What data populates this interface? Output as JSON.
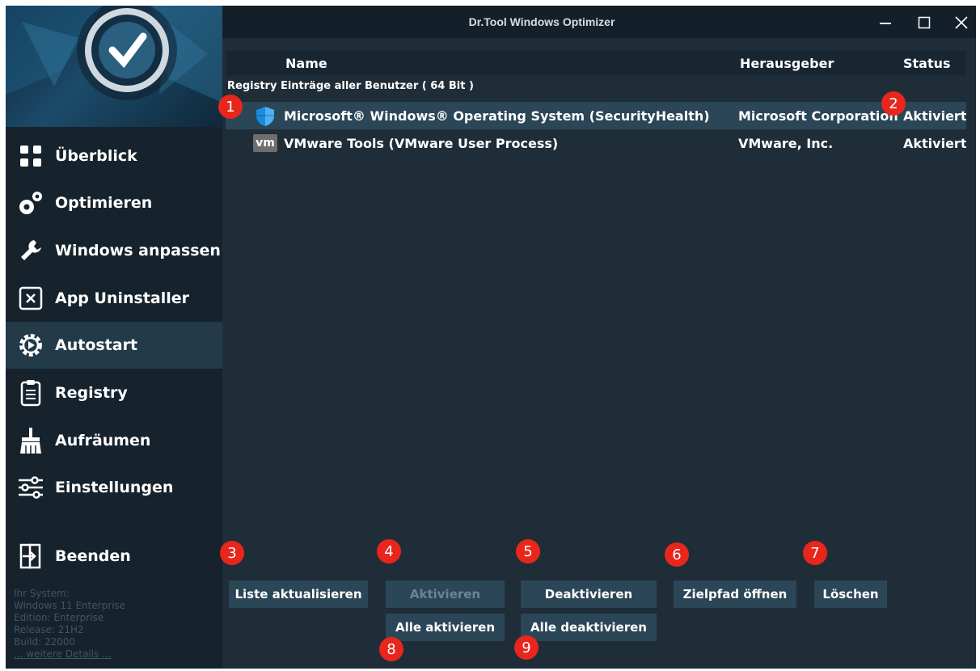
{
  "window": {
    "title": "Dr.Tool Windows Optimizer"
  },
  "sidebar": {
    "items": [
      {
        "label": "Überblick",
        "icon": "grid-icon",
        "active": false
      },
      {
        "label": "Optimieren",
        "icon": "gears-icon",
        "active": false
      },
      {
        "label": "Windows anpassen",
        "icon": "wrench-icon",
        "active": false
      },
      {
        "label": "App Uninstaller",
        "icon": "uninstall-icon",
        "active": false
      },
      {
        "label": "Autostart",
        "icon": "autostart-gear-icon",
        "active": true
      },
      {
        "label": "Registry",
        "icon": "clipboard-icon",
        "active": false
      },
      {
        "label": "Aufräumen",
        "icon": "broom-icon",
        "active": false
      },
      {
        "label": "Einstellungen",
        "icon": "sliders-icon",
        "active": false
      }
    ],
    "quit": {
      "label": "Beenden",
      "icon": "exit-icon"
    },
    "system_info": {
      "heading": "Ihr System:",
      "os": "Windows 11 Enterprise",
      "edition": "Edition: Enterprise",
      "release": "Release: 21H2",
      "build": "Build: 22000",
      "details_link": "... weitere Details ..."
    }
  },
  "list": {
    "columns": {
      "name": "Name",
      "publisher": "Herausgeber",
      "status": "Status"
    },
    "group_label": "Registry Einträge aller Benutzer ( 64 Bit )",
    "rows": [
      {
        "name": "Microsoft® Windows® Operating System (SecurityHealth)",
        "publisher": "Microsoft Corporation",
        "status": "Aktiviert",
        "icon": "shield-icon",
        "selected": true
      },
      {
        "name": "VMware Tools (VMware User Process)",
        "publisher": "VMware, Inc.",
        "status": "Aktiviert",
        "icon": "vm-icon",
        "icon_text": "vm",
        "selected": false
      }
    ]
  },
  "buttons": {
    "refresh": "Liste aktualisieren",
    "activate": "Aktivieren",
    "deactivate": "Deaktivieren",
    "open_path": "Zielpfad öffnen",
    "delete": "Löschen",
    "activate_all": "Alle aktivieren",
    "deactivate_all": "Alle deaktivieren"
  },
  "annotations": [
    "1",
    "2",
    "3",
    "4",
    "5",
    "6",
    "7",
    "8",
    "9"
  ],
  "colors": {
    "badge": "#e8261c",
    "accent": "#2b4656",
    "background": "#1f2d38",
    "sidebar": "#16232d"
  }
}
